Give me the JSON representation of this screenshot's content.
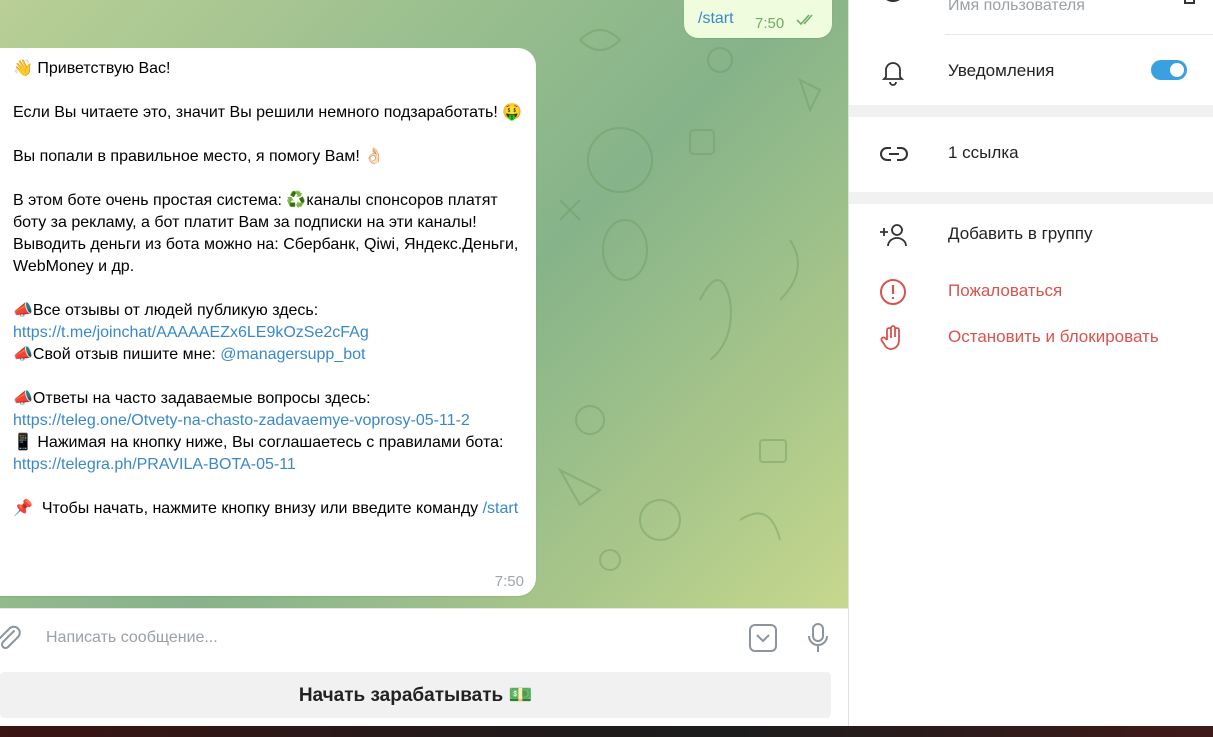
{
  "chat": {
    "outgoing": {
      "text": "/start",
      "time": "7:50"
    },
    "incoming": {
      "time": "7:50",
      "lines": {
        "greet": "👋 Приветствую Вас!",
        "p1": "Если Вы читаете это, значит Вы решили немного подзаработать! 🤑",
        "p2": "Вы попали в правильное место, я помогу Вам! 👌🏻",
        "p3a": "В этом боте очень простая система: ♻️каналы спонсоров платят боту за рекламу, а бот платит Вам за подписки на эти каналы!",
        "p3b": "Выводить деньги из бота можно на: Сбербанк, Qiwi, Яндекс.Деньги, WebMoney и др.",
        "rev_label": "📣Все отзывы от людей публикую здесь:",
        "rev_link": "https://t.me/joinchat/AAAAAEZx6LE9kOzSe2cFAg",
        "own_label": "📣Свой отзыв пишите мне: ",
        "own_link": "@managersupp_bot",
        "faq_label": "📣Ответы на часто задаваемые вопросы здесь:",
        "faq_link": "https://teleg.one/Otvety-na-chasto-zadavaemye-voprosy-05-11-2",
        "rules_label": "📱 Нажимая на кнопку ниже, Вы соглашаетесь с правилами бота: ",
        "rules_link": "https://telegra.ph/PRAVILA-BOTA-05-11",
        "start_label": "📌  Чтобы начать, нажмите кнопку внизу или введите команду ",
        "start_cmd": "/start"
      }
    }
  },
  "composer": {
    "placeholder": "Написать сообщение..."
  },
  "keyboard": {
    "button_label": "Начать зарабатывать 💵"
  },
  "sidebar": {
    "username_label": "Имя пользователя",
    "notifications_label": "Уведомления",
    "notifications_on": true,
    "links_label": "1 ссылка",
    "add_to_group": "Добавить в группу",
    "report": "Пожаловаться",
    "block": "Остановить и блокировать"
  },
  "colors": {
    "link": "#3a88c8",
    "danger": "#d9534f",
    "toggle": "#3aa0e0",
    "outgoing_bubble": "#effdde"
  }
}
